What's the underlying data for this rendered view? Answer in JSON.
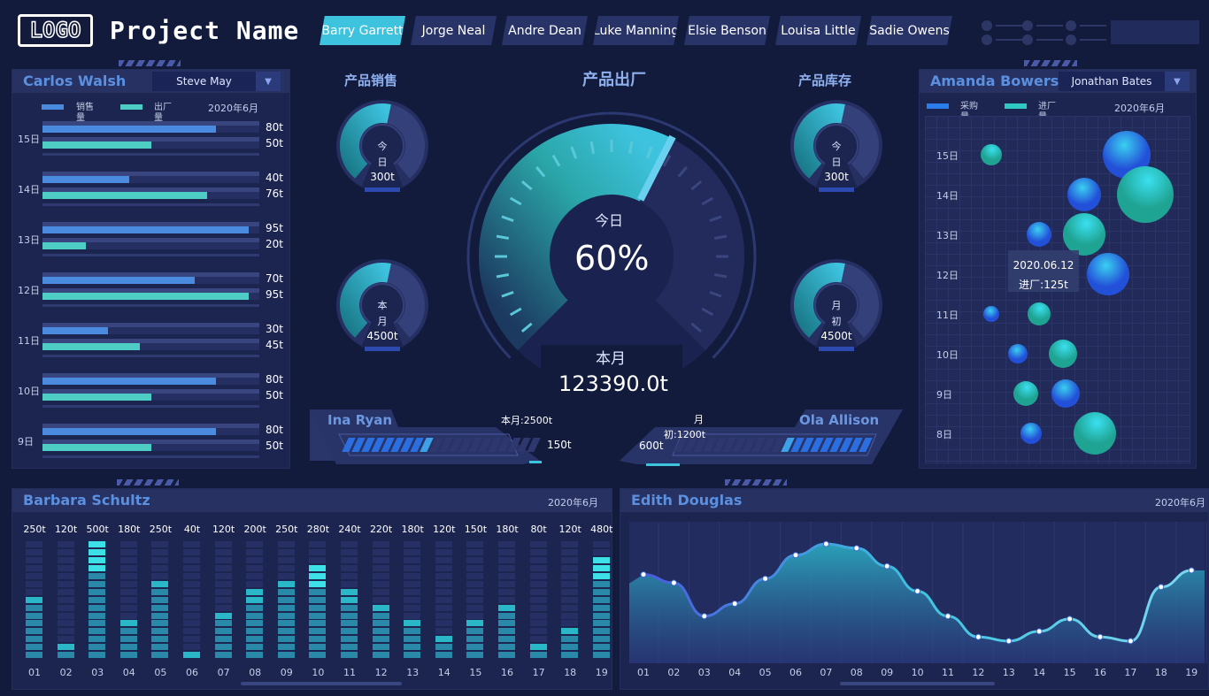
{
  "header": {
    "logo": "LOGO",
    "title": "Project Name",
    "tabs": [
      "Barry Garrett",
      "Jorge Neal",
      "Andre Dean",
      "Luke Manning",
      "Elsie Benson",
      "Louisa Little",
      "Sadie Owens"
    ],
    "active_tab": 0
  },
  "left_panel": {
    "title": "Carlos Walsh",
    "select": "Steve May",
    "legend": [
      "销售量",
      "出厂量"
    ],
    "date": "2020年6月",
    "rows": [
      {
        "day": "15日",
        "sales": 80,
        "out": 50,
        "sales_label": "80t",
        "out_label": "50t"
      },
      {
        "day": "14日",
        "sales": 40,
        "out": 76,
        "sales_label": "40t",
        "out_label": "76t"
      },
      {
        "day": "13日",
        "sales": 95,
        "out": 20,
        "sales_label": "95t",
        "out_label": "20t"
      },
      {
        "day": "12日",
        "sales": 70,
        "out": 95,
        "sales_label": "70t",
        "out_label": "95t"
      },
      {
        "day": "11日",
        "sales": 30,
        "out": 45,
        "sales_label": "30t",
        "out_label": "45t"
      },
      {
        "day": "10日",
        "sales": 80,
        "out": 50,
        "sales_label": "80t",
        "out_label": "50t"
      },
      {
        "day": "9日",
        "sales": 80,
        "out": 50,
        "sales_label": "80t",
        "out_label": "50t"
      }
    ]
  },
  "center": {
    "sales_title": "产品销售",
    "factory_title": "产品出厂",
    "stock_title": "产品库存",
    "gauges": [
      {
        "label": "今日",
        "value": "300t",
        "level": 0.35
      },
      {
        "label": "本月",
        "value": "4500t",
        "level": 0.35
      },
      {
        "label": "今日",
        "value": "300t",
        "level": 0.35
      },
      {
        "label": "月初",
        "value": "4500t",
        "level": 0.35
      }
    ],
    "main": {
      "today_label": "今日",
      "percent": "60%",
      "level": 0.6,
      "month_label": "本月",
      "month_value": "123390.0t"
    },
    "progress_left": {
      "name": "Ina Ryan",
      "target": "本月:2500t",
      "value": "150t",
      "level": 0.45
    },
    "progress_right": {
      "name": "Ola Allison",
      "target_a": "月",
      "target_b": "初:1200t",
      "value": "600t",
      "level": 0.45
    }
  },
  "right_panel": {
    "title": "Amanda Bowers",
    "select": "Jonathan Bates",
    "legend": [
      "采购量",
      "进厂量"
    ],
    "date": "2020年6月",
    "days": [
      "15日",
      "14日",
      "13日",
      "12日",
      "11日",
      "10日",
      "9日",
      "8日"
    ],
    "tooltip": {
      "date": "2020.06.12",
      "text": "进厂:125t"
    },
    "colors": {
      "purchase": "#2a7de8",
      "intake": "#2fc9c2"
    }
  },
  "bottom_left": {
    "title": "Barbara Schultz",
    "date": "2020年6月",
    "labels": [
      "250t",
      "120t",
      "500t",
      "180t",
      "250t",
      "40t",
      "120t",
      "200t",
      "250t",
      "280t",
      "240t",
      "220t",
      "180t",
      "120t",
      "150t",
      "180t",
      "80t",
      "120t",
      "480t"
    ],
    "x": [
      "01",
      "02",
      "03",
      "04",
      "05",
      "06",
      "07",
      "08",
      "09",
      "10",
      "11",
      "12",
      "13",
      "14",
      "15",
      "16",
      "17",
      "18",
      "19"
    ]
  },
  "bottom_right": {
    "title": "Edith Douglas",
    "date": "2020年6月"
  },
  "chart_data": [
    {
      "type": "bar",
      "title": "Carlos Walsh",
      "categories": [
        "15日",
        "14日",
        "13日",
        "12日",
        "11日",
        "10日",
        "9日"
      ],
      "series": [
        {
          "name": "销售量",
          "values": [
            80,
            40,
            95,
            70,
            30,
            80,
            80
          ]
        },
        {
          "name": "出厂量",
          "values": [
            50,
            76,
            20,
            95,
            45,
            50,
            50
          ]
        }
      ]
    },
    {
      "type": "scatter",
      "title": "Amanda Bowers",
      "series": [
        {
          "name": "采购量",
          "points": [
            {
              "x": 76,
              "day": "15日",
              "size": 27
            },
            {
              "x": 60,
              "day": "14日",
              "size": 19
            },
            {
              "x": 43,
              "day": "13日",
              "size": 14
            },
            {
              "x": 69,
              "day": "12日",
              "size": 24
            },
            {
              "x": 25,
              "day": "11日",
              "size": 9
            },
            {
              "x": 35,
              "day": "10日",
              "size": 11
            },
            {
              "x": 53,
              "day": "9日",
              "size": 16
            },
            {
              "x": 40,
              "day": "8日",
              "size": 12
            }
          ]
        },
        {
          "name": "进厂量",
          "points": [
            {
              "x": 25,
              "day": "15日",
              "size": 12
            },
            {
              "x": 83,
              "day": "14日",
              "size": 32
            },
            {
              "x": 60,
              "day": "13日",
              "size": 24
            },
            {
              "x": 43,
              "day": "11日",
              "size": 13
            },
            {
              "x": 52,
              "day": "10日",
              "size": 16
            },
            {
              "x": 38,
              "day": "9日",
              "size": 14
            },
            {
              "x": 64,
              "day": "8日",
              "size": 24
            }
          ]
        }
      ]
    },
    {
      "type": "bar",
      "title": "Barbara Schultz",
      "categories": [
        "01",
        "02",
        "03",
        "04",
        "05",
        "06",
        "07",
        "08",
        "09",
        "10",
        "11",
        "12",
        "13",
        "14",
        "15",
        "16",
        "17",
        "18",
        "19"
      ],
      "values": [
        250,
        120,
        500,
        180,
        250,
        40,
        120,
        200,
        250,
        280,
        240,
        220,
        180,
        120,
        150,
        180,
        80,
        120,
        480
      ],
      "fill_levels": [
        0.55,
        0.19,
        1.0,
        0.34,
        0.7,
        0.13,
        0.45,
        0.6,
        0.7,
        0.84,
        0.6,
        0.49,
        0.37,
        0.23,
        0.34,
        0.49,
        0.15,
        0.32,
        0.9
      ]
    },
    {
      "type": "area",
      "title": "Edith Douglas",
      "categories": [
        "01",
        "02",
        "03",
        "04",
        "05",
        "06",
        "07",
        "08",
        "09",
        "10",
        "11",
        "12",
        "13",
        "14",
        "15",
        "16",
        "17",
        "18",
        "19"
      ],
      "values": [
        64,
        58,
        34,
        43,
        61,
        78,
        86,
        83,
        70,
        52,
        34,
        19,
        16,
        23,
        32,
        19,
        16,
        55,
        67
      ]
    }
  ]
}
